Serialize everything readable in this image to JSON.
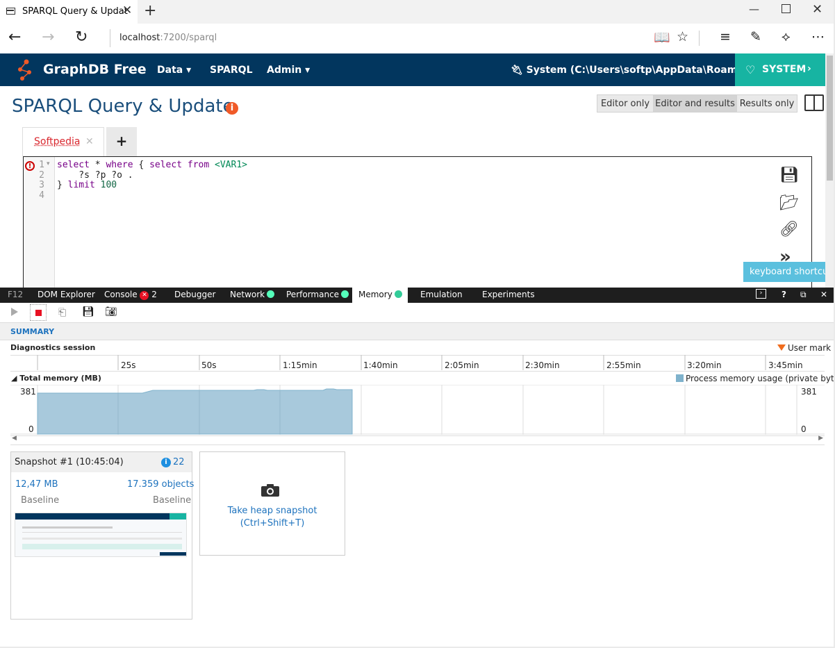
{
  "browser": {
    "tab_title": "SPARQL Query & Updat",
    "url_host": "localhost",
    "url_rest": ":7200/sparql"
  },
  "app": {
    "brand": "GraphDB Free",
    "nav": [
      "Data ▾",
      "SPARQL",
      "Admin ▾"
    ],
    "repository": "System (C:\\Users\\softp\\AppData\\Roaming...",
    "system_button": "SYSTEM",
    "accent": "#02365e",
    "system_color": "#17b4a2"
  },
  "page": {
    "title": "SPARQL Query & Update",
    "modes": [
      "Editor only",
      "Editor and results",
      "Results only"
    ],
    "active_mode": "Editor and results"
  },
  "query_tabs": {
    "tab_name": "Softpedia",
    "add": "+"
  },
  "editor": {
    "line_numbers": [
      "1",
      "2",
      "3",
      "4"
    ],
    "keyboard_shortcuts": "keyboard shortcuts"
  },
  "devtools": {
    "tabs": [
      "F12",
      "DOM Explorer",
      "Console",
      "Debugger",
      "Network",
      "Performance",
      "Memory",
      "Emulation",
      "Experiments"
    ],
    "console_errors": "2",
    "active_tab": "Memory",
    "summary": "SUMMARY",
    "diag_label": "Diagnostics session",
    "user_mark": "User mark",
    "ticks": [
      "25s",
      "50s",
      "1:15min",
      "1:40min",
      "2:05min",
      "2:30min",
      "2:55min",
      "3:20min",
      "3:45min"
    ],
    "memory_label": "Total memory (MB)",
    "legend": "Process memory usage (private bytes)",
    "y_max": "381",
    "y_min": "0"
  },
  "snapshot": {
    "title": "Snapshot #1",
    "time": "(10:45:04)",
    "count": "22",
    "size": "12,47 MB",
    "objects": "17.359 objects",
    "baseline_left": "Baseline",
    "baseline_right": "Baseline"
  },
  "take_snapshot": {
    "line1": "Take heap snapshot",
    "line2": "(Ctrl+Shift+T)"
  }
}
